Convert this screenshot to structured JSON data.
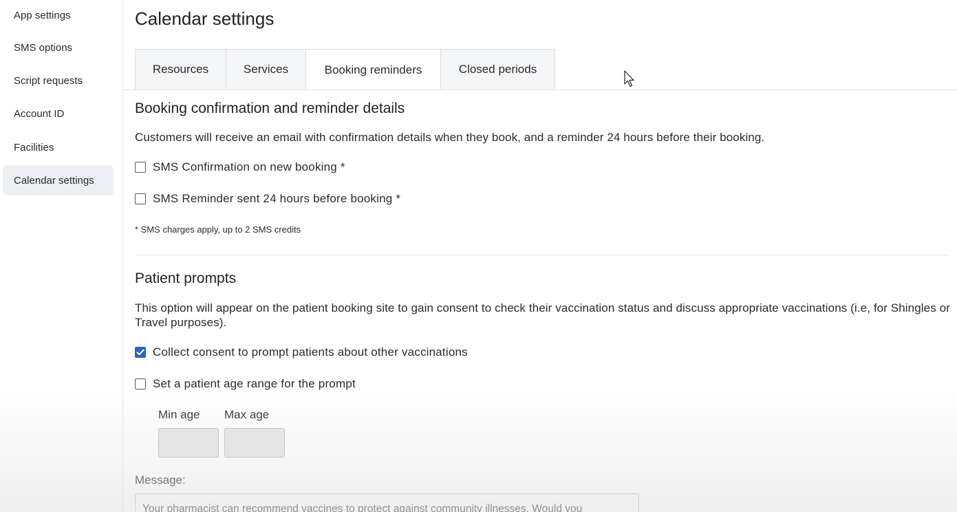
{
  "sidebar": {
    "items": [
      {
        "label": "App settings"
      },
      {
        "label": "SMS options"
      },
      {
        "label": "Script requests"
      },
      {
        "label": "Account ID"
      },
      {
        "label": "Facilities"
      },
      {
        "label": "Calendar settings",
        "active": true
      }
    ]
  },
  "page": {
    "title": "Calendar settings"
  },
  "tabs": [
    {
      "label": "Resources"
    },
    {
      "label": "Services"
    },
    {
      "label": "Booking reminders",
      "active": true
    },
    {
      "label": "Closed periods"
    }
  ],
  "booking_section": {
    "title": "Booking confirmation and reminder details",
    "description": "Customers will receive an email with confirmation details when they book, and a reminder 24 hours before their booking.",
    "sms_confirmation": {
      "label": "SMS Confirmation on new booking *",
      "checked": false
    },
    "sms_reminder": {
      "label": "SMS Reminder sent 24 hours before booking *",
      "checked": false
    },
    "note": "* SMS charges apply, up to 2 SMS credits"
  },
  "patient_prompts": {
    "title": "Patient prompts",
    "description": "This option will appear on the patient booking site to gain consent to check their vaccination status and discuss appropriate vaccinations (i.e, for Shingles or Travel purposes).",
    "collect_consent": {
      "label": "Collect consent to prompt patients about other vaccinations",
      "checked": true
    },
    "age_range": {
      "label": "Set a patient age range for the prompt",
      "checked": false
    },
    "min_age": {
      "label": "Min age",
      "value": ""
    },
    "max_age": {
      "label": "Max age",
      "value": ""
    },
    "message_label": "Message:",
    "message_value": "Your pharmacist can recommend vaccines to protect against community illnesses. Would you"
  },
  "colors": {
    "accent": "#2f64c6",
    "sidebar_active_bg": "#eceff3",
    "tab_inactive_bg": "#f4f5f7"
  }
}
